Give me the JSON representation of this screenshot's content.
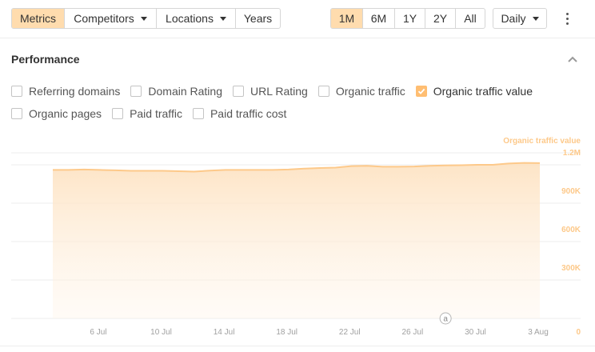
{
  "toolbar": {
    "tabs": [
      {
        "label": "Metrics",
        "active": true,
        "dropdown": false
      },
      {
        "label": "Competitors",
        "active": false,
        "dropdown": true
      },
      {
        "label": "Locations",
        "active": false,
        "dropdown": true
      },
      {
        "label": "Years",
        "active": false,
        "dropdown": false
      }
    ],
    "ranges": [
      {
        "label": "1M",
        "active": true
      },
      {
        "label": "6M",
        "active": false
      },
      {
        "label": "1Y",
        "active": false
      },
      {
        "label": "2Y",
        "active": false
      },
      {
        "label": "All",
        "active": false
      }
    ],
    "interval_label": "Daily",
    "more_icon": "kebab-icon"
  },
  "panel": {
    "title": "Performance",
    "collapse_icon": "chevron-up-icon"
  },
  "metrics": [
    [
      {
        "label": "Referring domains",
        "checked": false
      },
      {
        "label": "Domain Rating",
        "checked": false
      },
      {
        "label": "URL Rating",
        "checked": false
      },
      {
        "label": "Organic traffic",
        "checked": false
      },
      {
        "label": "Organic traffic value",
        "checked": true
      }
    ],
    [
      {
        "label": "Organic pages",
        "checked": false
      },
      {
        "label": "Paid traffic",
        "checked": false
      },
      {
        "label": "Paid traffic cost",
        "checked": false
      }
    ]
  ],
  "colors": {
    "accent": "#ffdcae",
    "series": "#fdc98a",
    "axis_text": "#b0b0b0",
    "grid": "#ececec"
  },
  "chart_data": {
    "type": "area",
    "series_label": "Organic traffic value",
    "x_ticks": [
      "6 Jul",
      "10 Jul",
      "14 Jul",
      "18 Jul",
      "22 Jul",
      "26 Jul",
      "30 Jul",
      "3 Aug"
    ],
    "x_tick_days": [
      6,
      10,
      14,
      18,
      22,
      26,
      30,
      34
    ],
    "y_ticks": [
      "0",
      "300K",
      "600K",
      "900K",
      "1.2M"
    ],
    "y_tick_values": [
      0,
      300000,
      600000,
      900000,
      1200000
    ],
    "ylim": [
      0,
      1200000
    ],
    "grid": true,
    "annotation_marker": "a",
    "annotation_day": 28,
    "series": [
      {
        "name": "Organic traffic value",
        "x": [
          3,
          4,
          5,
          6,
          7,
          8,
          9,
          10,
          11,
          12,
          13,
          14,
          15,
          16,
          17,
          18,
          19,
          20,
          21,
          22,
          23,
          24,
          25,
          26,
          27,
          28,
          29,
          30,
          31,
          32,
          33,
          34
        ],
        "values": [
          1160000,
          1160000,
          1163000,
          1160000,
          1157000,
          1153000,
          1153000,
          1153000,
          1150000,
          1147000,
          1155000,
          1160000,
          1160000,
          1160000,
          1160000,
          1163000,
          1170000,
          1175000,
          1178000,
          1190000,
          1192000,
          1185000,
          1185000,
          1187000,
          1192000,
          1195000,
          1197000,
          1200000,
          1200000,
          1210000,
          1215000,
          1213000
        ]
      }
    ]
  }
}
